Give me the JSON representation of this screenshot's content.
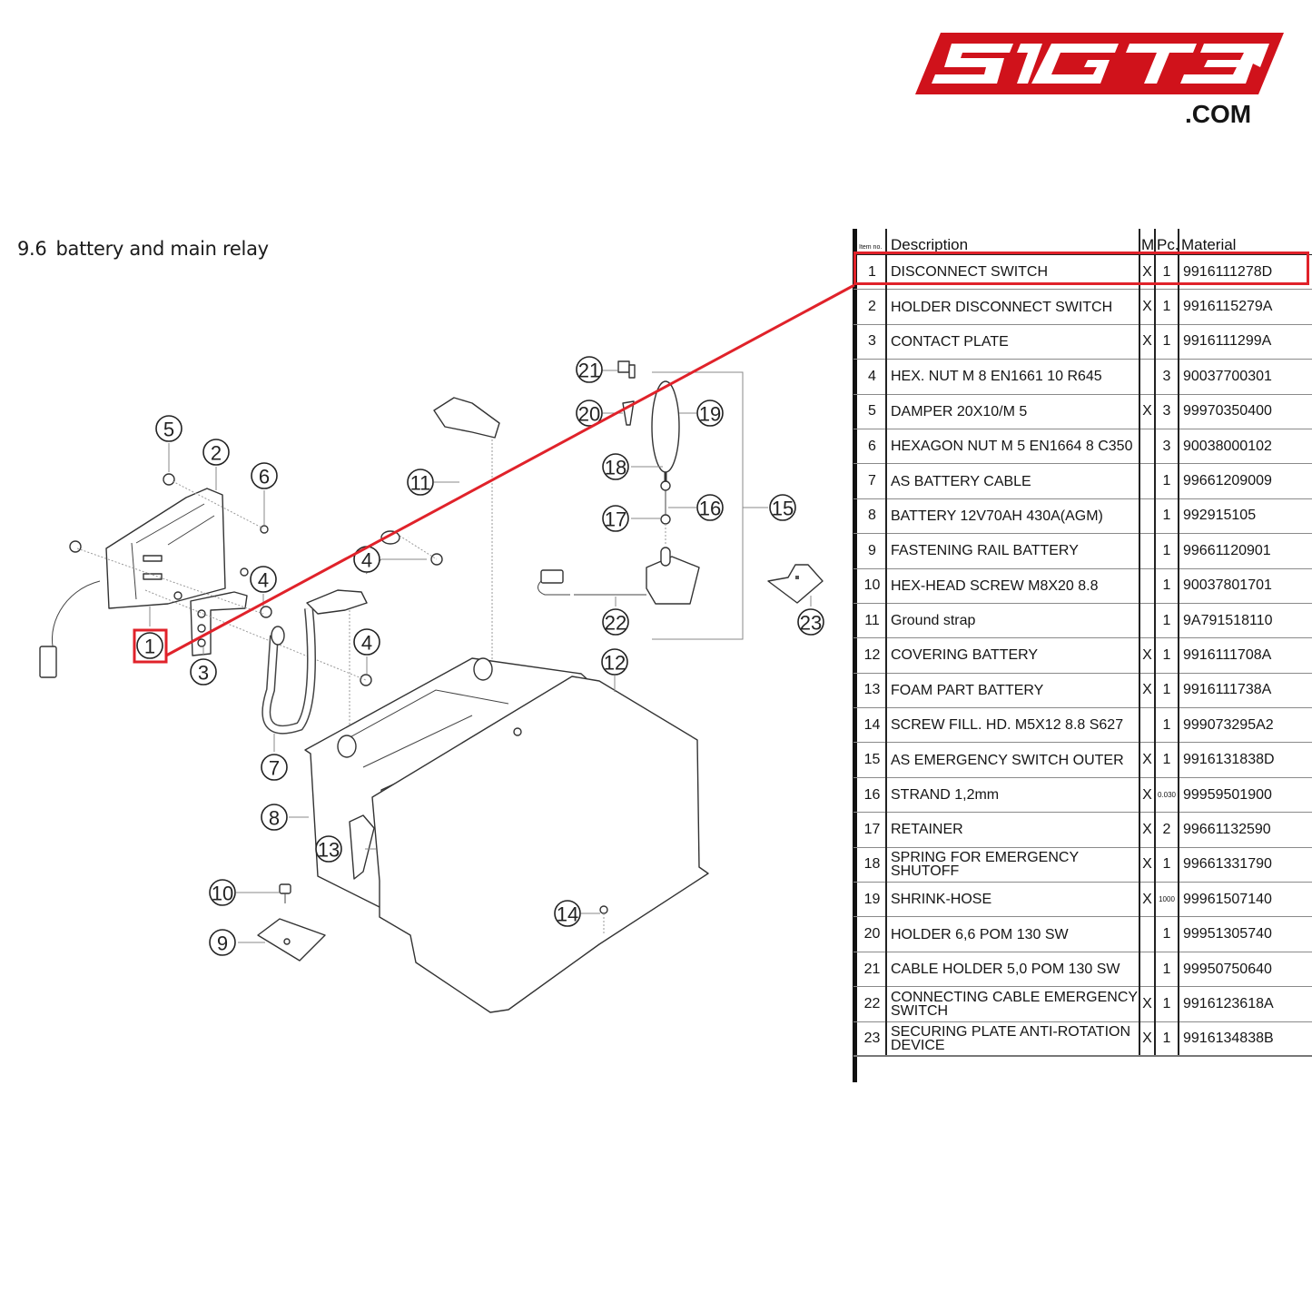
{
  "brand": {
    "logo_text": "SIGT3",
    "logo_suffix": ".COM",
    "brand_color": "#D0121B"
  },
  "section": {
    "number": "9.6",
    "title": "battery and main relay"
  },
  "highlight": {
    "item_no": "1",
    "color": "#E0222A"
  },
  "table": {
    "headers": {
      "item": "Item no.",
      "description": "Description",
      "m": "M",
      "pc": "Pc.",
      "material": "Material"
    },
    "rows": [
      {
        "item": "1",
        "description": "DISCONNECT SWITCH",
        "m": "X",
        "pc": "1",
        "material": "9916111278D"
      },
      {
        "item": "2",
        "description": "HOLDER DISCONNECT SWITCH",
        "m": "X",
        "pc": "1",
        "material": "9916115279A"
      },
      {
        "item": "3",
        "description": "CONTACT PLATE",
        "m": "X",
        "pc": "1",
        "material": "9916111299A"
      },
      {
        "item": "4",
        "description": "HEX. NUT M 8 EN1661 10 R645",
        "m": "",
        "pc": "3",
        "material": "90037700301"
      },
      {
        "item": "5",
        "description": "DAMPER 20X10/M 5",
        "m": "X",
        "pc": "3",
        "material": "99970350400"
      },
      {
        "item": "6",
        "description": "HEXAGON NUT M 5 EN1664 8 C350",
        "m": "",
        "pc": "3",
        "material": "90038000102"
      },
      {
        "item": "7",
        "description": "AS BATTERY CABLE",
        "m": "",
        "pc": "1",
        "material": "99661209009"
      },
      {
        "item": "8",
        "description": "BATTERY 12V70AH 430A(AGM)",
        "m": "",
        "pc": "1",
        "material": "992915105"
      },
      {
        "item": "9",
        "description": "FASTENING RAIL BATTERY",
        "m": "",
        "pc": "1",
        "material": "99661120901"
      },
      {
        "item": "10",
        "description": "HEX-HEAD SCREW M8X20 8.8",
        "m": "",
        "pc": "1",
        "material": "90037801701"
      },
      {
        "item": "11",
        "description": "Ground strap",
        "m": "",
        "pc": "1",
        "material": "9A791518110"
      },
      {
        "item": "12",
        "description": "COVERING BATTERY",
        "m": "X",
        "pc": "1",
        "material": "9916111708A"
      },
      {
        "item": "13",
        "description": "FOAM PART BATTERY",
        "m": "X",
        "pc": "1",
        "material": "9916111738A"
      },
      {
        "item": "14",
        "description": "SCREW FILL. HD. M5X12 8.8 S627",
        "m": "",
        "pc": "1",
        "material": "999073295A2"
      },
      {
        "item": "15",
        "description": "AS EMERGENCY SWITCH OUTER",
        "m": "X",
        "pc": "1",
        "material": "9916131838D"
      },
      {
        "item": "16",
        "description": "STRAND 1,2mm",
        "m": "X",
        "pc": "0.030",
        "material": "99959501900"
      },
      {
        "item": "17",
        "description": "RETAINER",
        "m": "X",
        "pc": "2",
        "material": "99661132590"
      },
      {
        "item": "18",
        "description": "SPRING FOR EMERGENCY SHUTOFF",
        "m": "X",
        "pc": "1",
        "material": "99661331790"
      },
      {
        "item": "19",
        "description": "SHRINK-HOSE",
        "m": "X",
        "pc": "1000",
        "material": "99961507140"
      },
      {
        "item": "20",
        "description": "HOLDER 6,6 POM 130 SW",
        "m": "",
        "pc": "1",
        "material": "99951305740"
      },
      {
        "item": "21",
        "description": "CABLE HOLDER 5,0 POM 130 SW",
        "m": "",
        "pc": "1",
        "material": "99950750640"
      },
      {
        "item": "22",
        "description": "CONNECTING CABLE EMERGENCY SWITCH",
        "m": "X",
        "pc": "1",
        "material": "9916123618A"
      },
      {
        "item": "23",
        "description": "SECURING PLATE ANTI-ROTATION DEVICE",
        "m": "X",
        "pc": "1",
        "material": "9916134838B"
      }
    ]
  },
  "diagram": {
    "callouts": [
      {
        "label": "1"
      },
      {
        "label": "2"
      },
      {
        "label": "3"
      },
      {
        "label": "4"
      },
      {
        "label": "4"
      },
      {
        "label": "4"
      },
      {
        "label": "4"
      },
      {
        "label": "5"
      },
      {
        "label": "6"
      },
      {
        "label": "7"
      },
      {
        "label": "8"
      },
      {
        "label": "9"
      },
      {
        "label": "10"
      },
      {
        "label": "11"
      },
      {
        "label": "12"
      },
      {
        "label": "13"
      },
      {
        "label": "14"
      },
      {
        "label": "15"
      },
      {
        "label": "16"
      },
      {
        "label": "17"
      },
      {
        "label": "18"
      },
      {
        "label": "19"
      },
      {
        "label": "20"
      },
      {
        "label": "21"
      },
      {
        "label": "22"
      },
      {
        "label": "23"
      }
    ]
  }
}
